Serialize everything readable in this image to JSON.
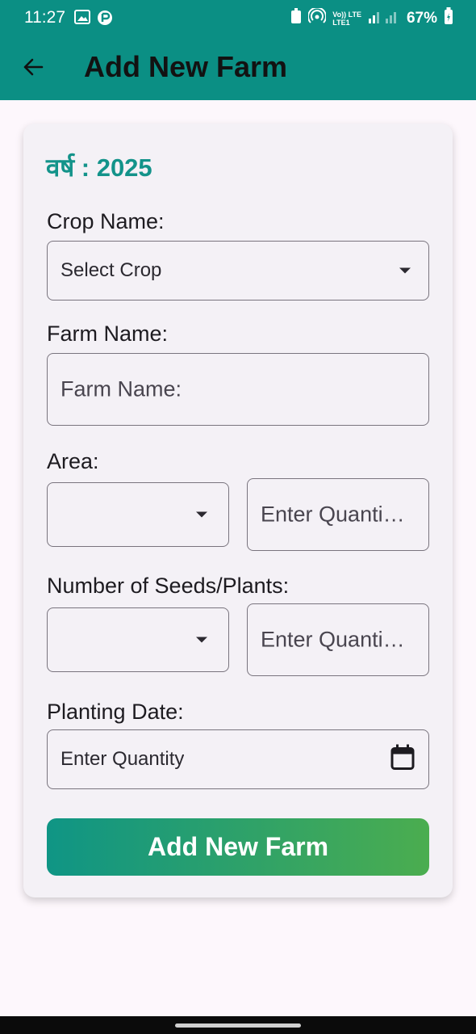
{
  "status_bar": {
    "time": "11:27",
    "battery": "67%",
    "network_label_top": "Vo)) LTE",
    "network_label_bottom": "LTE1"
  },
  "app_bar": {
    "title": "Add New Farm",
    "back_icon": "arrow-left-icon"
  },
  "form": {
    "year_label": "वर्ष : 2025",
    "crop": {
      "label": "Crop Name:",
      "value": "Select Crop"
    },
    "farm_name": {
      "label": "Farm Name:",
      "placeholder": "Farm Name:"
    },
    "area": {
      "label": "Area:",
      "unit_value": "",
      "quantity_placeholder": "Enter Quanti…"
    },
    "seeds": {
      "label": "Number of Seeds/Plants:",
      "unit_value": "",
      "quantity_placeholder": "Enter Quanti…"
    },
    "planting_date": {
      "label": "Planting Date:",
      "value": "Enter Quantity",
      "icon": "calendar-icon"
    },
    "submit_label": "Add New Farm"
  },
  "colors": {
    "primary": "#0b8f84",
    "year_text": "#13938a",
    "gradient_start": "#0f9585",
    "gradient_end": "#4bad4f"
  }
}
